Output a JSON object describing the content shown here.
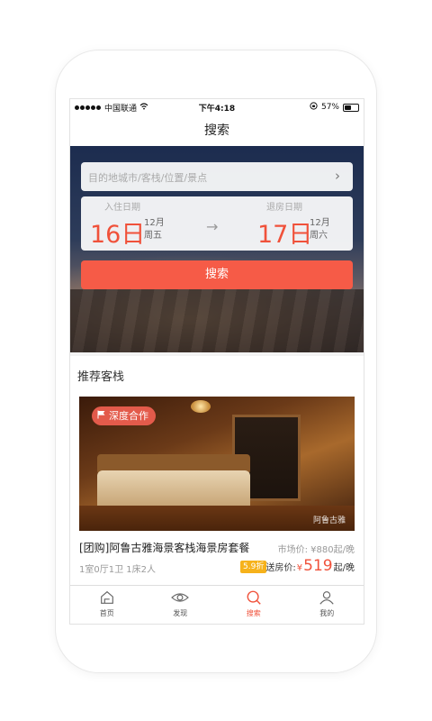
{
  "statusbar": {
    "carrier": "中国联通",
    "time": "下午4:18",
    "battery": "57%",
    "battery_level": 0.57
  },
  "header": {
    "title": "搜索"
  },
  "search": {
    "destination_placeholder": "目的地城市/客栈/位置/景点",
    "checkin": {
      "label": "入住日期",
      "day": "16日",
      "month": "12月",
      "weekday": "周五"
    },
    "checkout": {
      "label": "退房日期",
      "day": "17日",
      "month": "12月",
      "weekday": "周六"
    },
    "button_label": "搜索"
  },
  "recommend": {
    "title": "推荐客栈",
    "hotel": {
      "badge": "深度合作",
      "watermark": "阿鲁古雅",
      "name": "[团购]阿鲁古雅海景客栈海景房套餐",
      "market_price": "市场价: ¥880起/晚",
      "rooms": "1室0厅1卫  1床2人",
      "discount": "5.9折",
      "price_prefix": "送房价:",
      "currency": "¥",
      "price": "519",
      "price_suffix": "起/晚"
    }
  },
  "tabbar": {
    "items": [
      {
        "label": "首页",
        "icon": "home-icon"
      },
      {
        "label": "发现",
        "icon": "eye-icon"
      },
      {
        "label": "搜索",
        "icon": "search-icon",
        "active": true
      },
      {
        "label": "我的",
        "icon": "user-icon"
      }
    ]
  },
  "colors": {
    "accent": "#f0513a",
    "button": "#f65b47",
    "discount": "#f6b21b"
  }
}
